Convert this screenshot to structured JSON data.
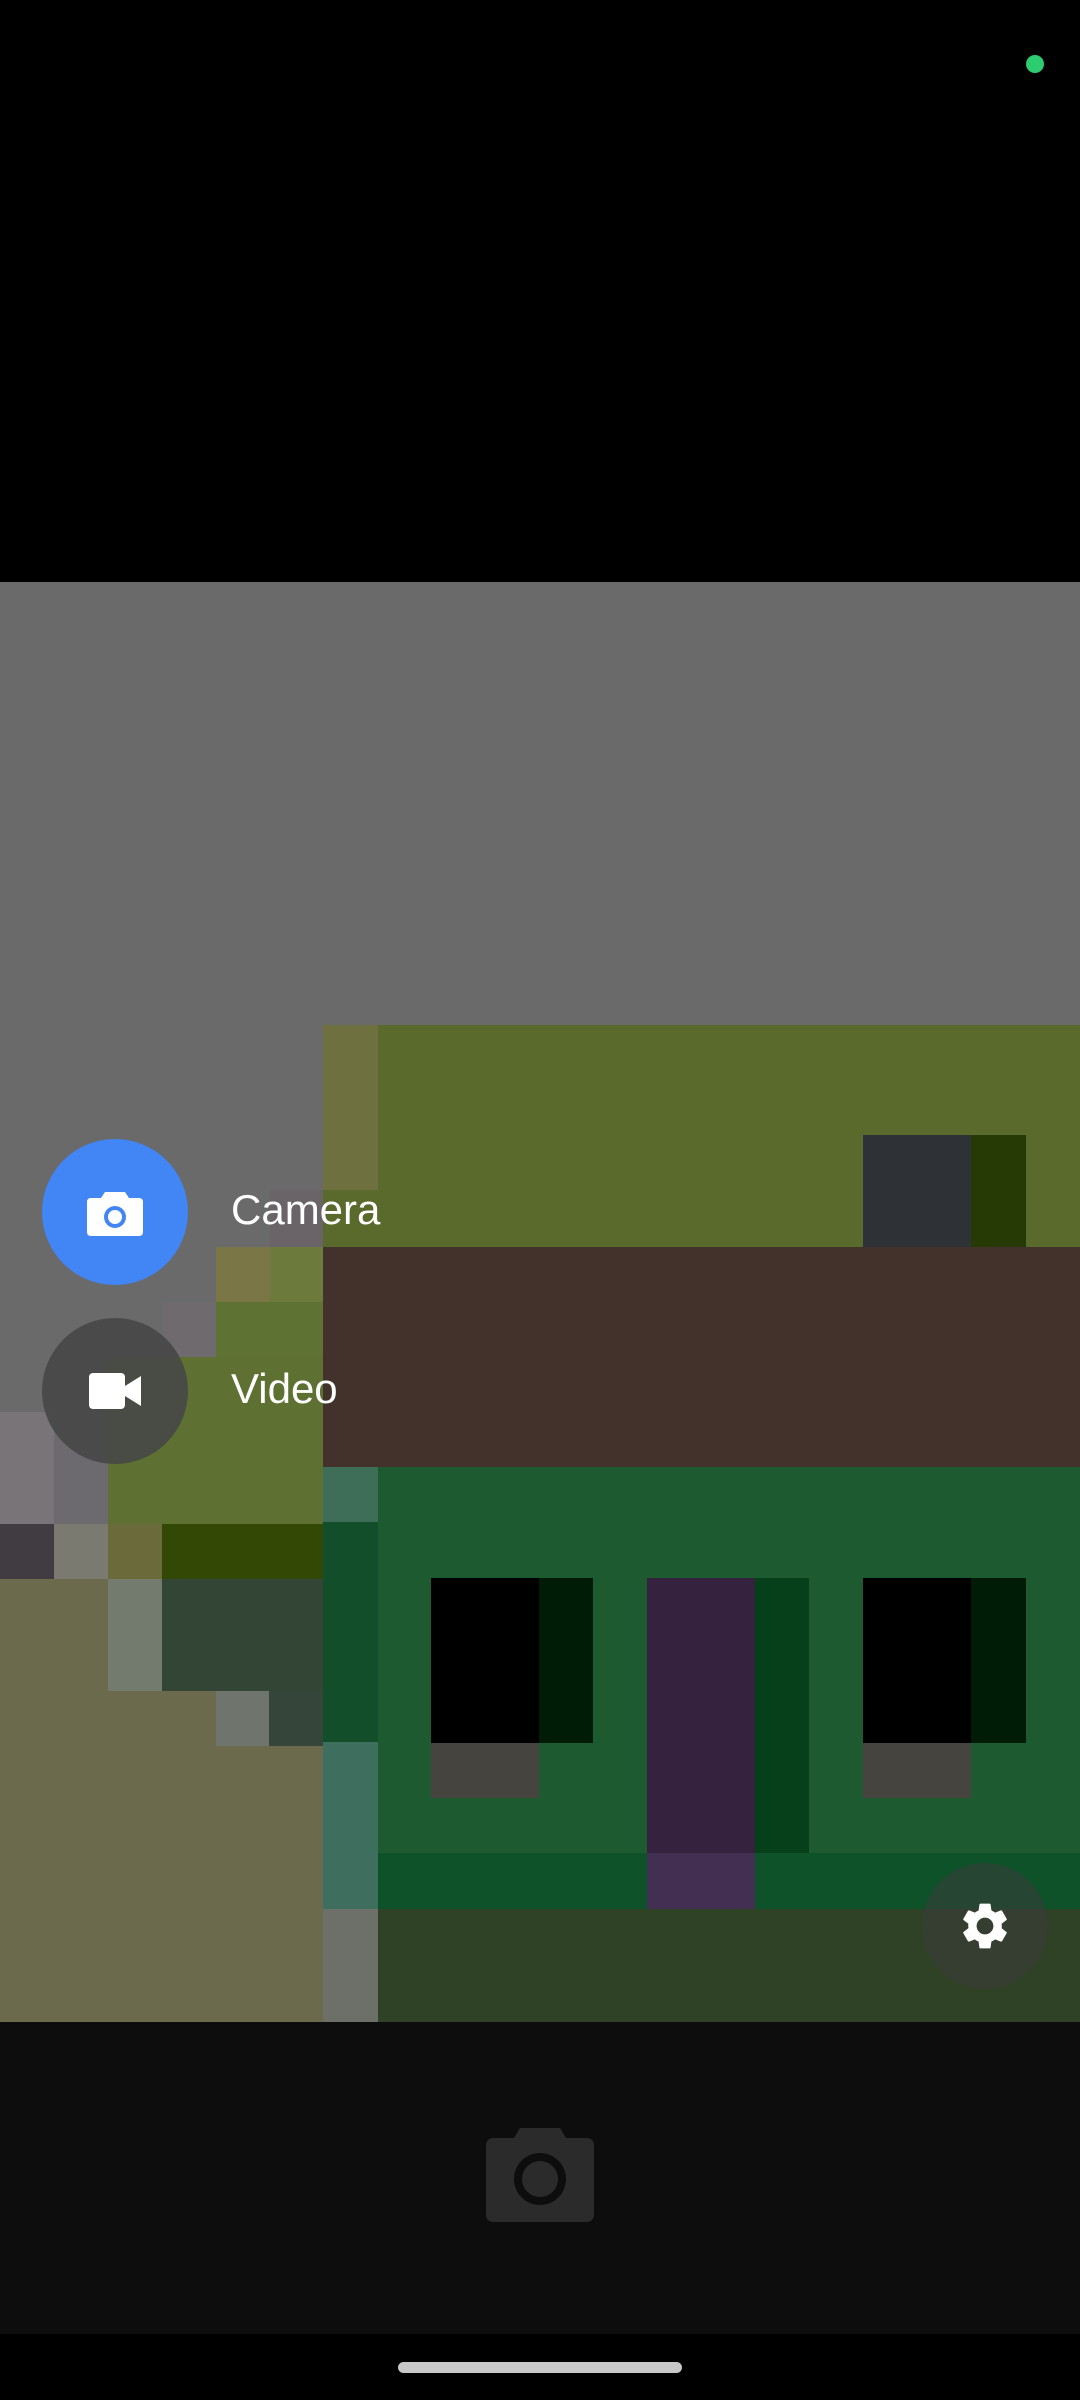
{
  "status": {
    "privacy_indicator_color": "#2ecc71"
  },
  "modes": [
    {
      "label": "Camera",
      "icon": "camera-icon",
      "selected": true,
      "color": "#4285f4"
    },
    {
      "label": "Video",
      "icon": "video-camera-icon",
      "selected": false,
      "color": "#474747"
    }
  ],
  "controls": {
    "settings_icon": "gear-icon",
    "shutter_icon": "camera-icon",
    "shutter_enabled": false
  }
}
